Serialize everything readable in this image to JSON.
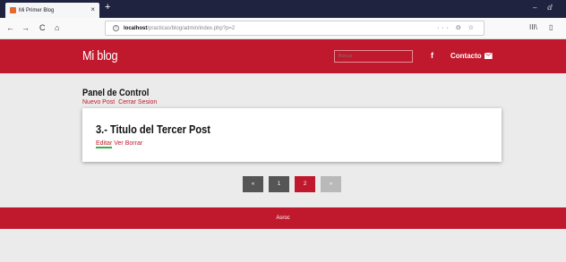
{
  "browser": {
    "tab_title": "Mi Primer Blog",
    "tab_close": "×",
    "new_tab": "+",
    "url_host": "localhost",
    "url_path": "/practicas/blog/admin/index.php?p=2",
    "url_actions": "··· ⊙ ☆",
    "back": "←",
    "forward": "→",
    "reload": "C",
    "home": "⌂",
    "minimize": "–",
    "maximize": "ⅆ",
    "library": "III\\",
    "sidebar": "▯"
  },
  "header": {
    "brand": "Mi blog",
    "search_placeholder": "Buscar",
    "facebook": "f",
    "contact_label": "Contacto"
  },
  "panel": {
    "title": "Panel de Control",
    "links": [
      "Nuevo Post",
      "Cerrar Sesion"
    ]
  },
  "post": {
    "title": "3.- Titulo del Tercer Post",
    "actions": [
      "Editar",
      "Ver",
      "Borrar"
    ]
  },
  "pagination": {
    "prev": "«",
    "pages": [
      "1",
      "2"
    ],
    "active": "2",
    "next": "»"
  },
  "footer": {
    "text": "Asroc"
  },
  "colors": {
    "brand": "#c0192d",
    "background": "#ebebeb"
  }
}
